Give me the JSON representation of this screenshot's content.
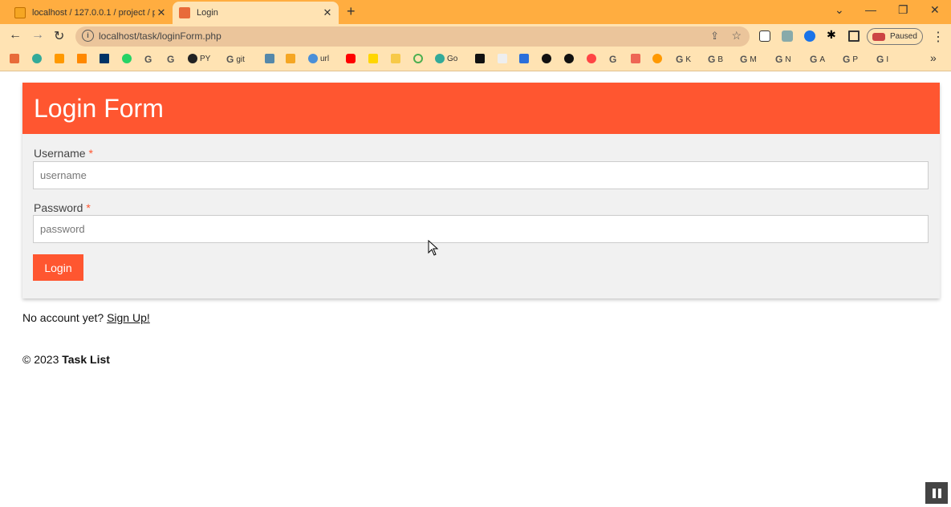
{
  "browser": {
    "tabs": [
      {
        "title": "localhost / 127.0.0.1 / project / p",
        "close": "✕"
      },
      {
        "title": "Login",
        "close": "✕"
      }
    ],
    "new_tab": "+",
    "window_controls": {
      "chevron": "⌄",
      "minimize": "—",
      "restore": "❐",
      "close": "✕"
    },
    "url": "localhost/task/loginForm.php",
    "profile_status": "Paused",
    "bookmarks": [
      "PY",
      "git",
      "url",
      "Go",
      "K",
      "B",
      "M",
      "N",
      "A",
      "P",
      "I"
    ],
    "more_bookmarks": "»"
  },
  "login": {
    "title": "Login Form",
    "username_label": "Username",
    "username_placeholder": "username",
    "password_label": "Password",
    "password_placeholder": "password",
    "required_mark": "*",
    "submit_label": "Login"
  },
  "signup": {
    "prompt": "No account yet?",
    "link_label": "Sign Up!"
  },
  "footer": {
    "copyright": "© 2023",
    "brand": "Task List"
  },
  "colors": {
    "accent": "#ff5630",
    "tabbar": "#ffad40",
    "toolbar": "#ffe3b3"
  }
}
